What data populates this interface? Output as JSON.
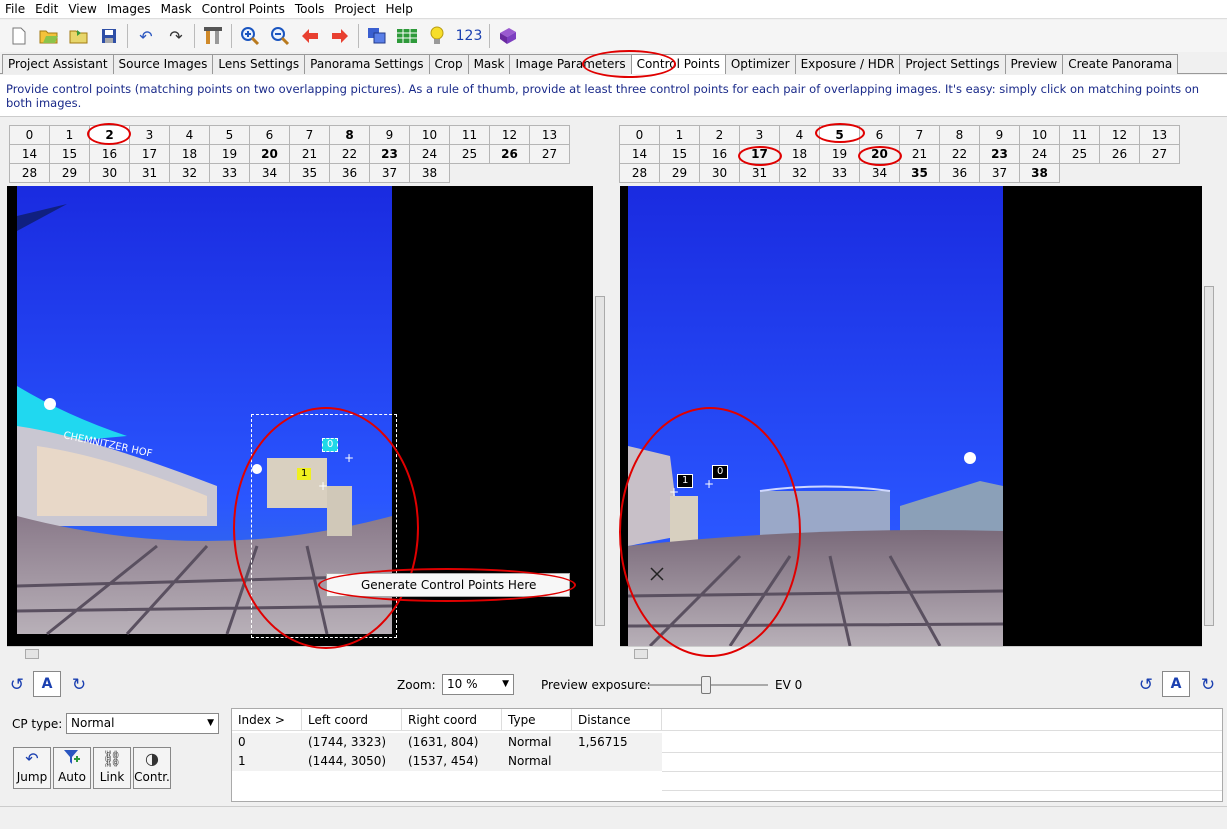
{
  "menu": [
    "File",
    "Edit",
    "View",
    "Images",
    "Mask",
    "Control Points",
    "Tools",
    "Project",
    "Help"
  ],
  "toolbar": {
    "icons": [
      "new-file-icon",
      "open-folder-icon",
      "open-recent-icon",
      "save-icon",
      "undo-icon",
      "redo-icon",
      "assistant-icon",
      "zoom-in-icon",
      "zoom-out-icon",
      "left-arrow-icon",
      "right-arrow-icon",
      "fast-preview-icon",
      "gl-preview-icon",
      "light-bulb-icon",
      "numbers-icon",
      "help-book-icon"
    ],
    "numbers_label": "123"
  },
  "tabs": [
    "Project Assistant",
    "Source Images",
    "Lens Settings",
    "Panorama Settings",
    "Crop",
    "Mask",
    "Image Parameters",
    "Control Points",
    "Optimizer",
    "Exposure / HDR",
    "Project Settings",
    "Preview",
    "Create Panorama"
  ],
  "active_tab": "Control Points",
  "help_text": "Provide control points (matching points on two overlapping pictures). As a rule of thumb, provide at least three control points for each pair of overlapping images. It's easy: simply click on matching points on both images.",
  "left_images": {
    "numbers": [
      "0",
      "1",
      "2",
      "3",
      "4",
      "5",
      "6",
      "7",
      "8",
      "9",
      "10",
      "11",
      "12",
      "13",
      "14",
      "15",
      "16",
      "17",
      "18",
      "19",
      "20",
      "21",
      "22",
      "23",
      "24",
      "25",
      "26",
      "27",
      "28",
      "29",
      "30",
      "31",
      "32",
      "33",
      "34",
      "35",
      "36",
      "37",
      "38"
    ],
    "bold": [
      "2",
      "8",
      "20",
      "23",
      "26"
    ],
    "selected": "2"
  },
  "right_images": {
    "numbers": [
      "0",
      "1",
      "2",
      "3",
      "4",
      "5",
      "6",
      "7",
      "8",
      "9",
      "10",
      "11",
      "12",
      "13",
      "14",
      "15",
      "16",
      "17",
      "18",
      "19",
      "20",
      "21",
      "22",
      "23",
      "24",
      "25",
      "26",
      "27",
      "28",
      "29",
      "30",
      "31",
      "32",
      "33",
      "34",
      "35",
      "36",
      "37",
      "38"
    ],
    "bold": [
      "5",
      "17",
      "20",
      "23",
      "35",
      "38"
    ],
    "selected": "5"
  },
  "left_viewer": {
    "cp_labels": [
      "0",
      "1"
    ],
    "building_sign": "CHEMNITZER HOF"
  },
  "right_viewer": {
    "cp_labels": [
      "1",
      "0"
    ]
  },
  "context_menu": {
    "item": "Generate Control Points Here"
  },
  "controls": {
    "zoom_label": "Zoom:",
    "zoom_value": "10 %",
    "exposure_label": "Preview exposure:",
    "exposure_level": 0.5,
    "ev_label": "EV 0",
    "auto_label": "A"
  },
  "cp_type": {
    "label": "CP type:",
    "value": "Normal"
  },
  "buttons": [
    {
      "label": "Jump",
      "icon": "jump-icon"
    },
    {
      "label": "Auto",
      "icon": "auto-icon"
    },
    {
      "label": "Link",
      "icon": "link-icon"
    },
    {
      "label": "Contr.",
      "icon": "contrast-icon"
    }
  ],
  "cp_table": {
    "columns": [
      "Index >",
      "Left coord",
      "Right coord",
      "Type",
      "Distance"
    ],
    "rows": [
      {
        "index": "0",
        "left": "(1744, 3323)",
        "right": "(1631, 804)",
        "type": "Normal",
        "distance": "1,56715"
      },
      {
        "index": "1",
        "left": "(1444, 3050)",
        "right": "(1537, 454)",
        "type": "Normal",
        "distance": ""
      }
    ]
  }
}
